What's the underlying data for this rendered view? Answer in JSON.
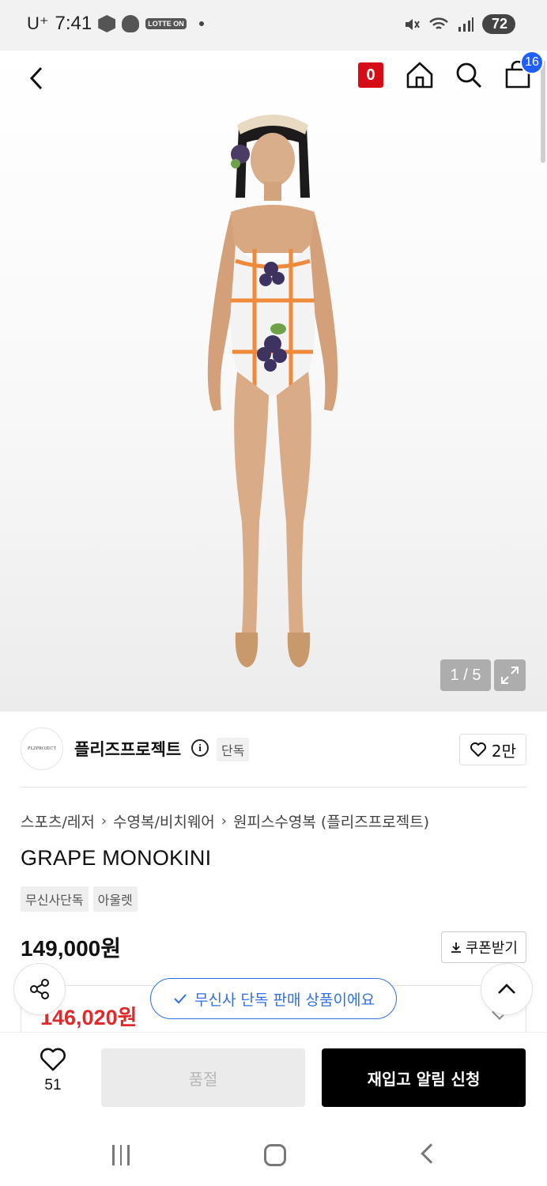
{
  "status_bar": {
    "carrier": "U⁺",
    "time": "7:41",
    "lotte_badge": "LOTTE ON",
    "battery": "72"
  },
  "header": {
    "brand_badge": "0",
    "cart_count": "16"
  },
  "gallery": {
    "counter": "1 / 5"
  },
  "brand": {
    "logo_text": "PLZPROJECT",
    "name": "플리즈프로젝트",
    "info_glyph": "i",
    "tag": "단독",
    "likes": "2만"
  },
  "breadcrumb": [
    "스포츠/레저",
    "수영복/비치웨어",
    "원피스수영복 (플리즈프로젝트)"
  ],
  "product": {
    "title": "GRAPE MONOKINI",
    "tags": [
      "무신사단독",
      "아울렛"
    ],
    "price": "149,000원",
    "coupon_label": "쿠폰받기",
    "sale_price": "146,020원"
  },
  "toast": {
    "text": "무신사 단독 판매 상품이에요"
  },
  "bottom_bar": {
    "wish_count": "51",
    "soldout_label": "품절",
    "restock_label": "재입고 알림 신청"
  },
  "colors": {
    "accent_blue": "#2f6fe8",
    "badge_blue": "#1f5fff",
    "sale_red": "#e02a2a",
    "brand_red": "#d60d17"
  }
}
